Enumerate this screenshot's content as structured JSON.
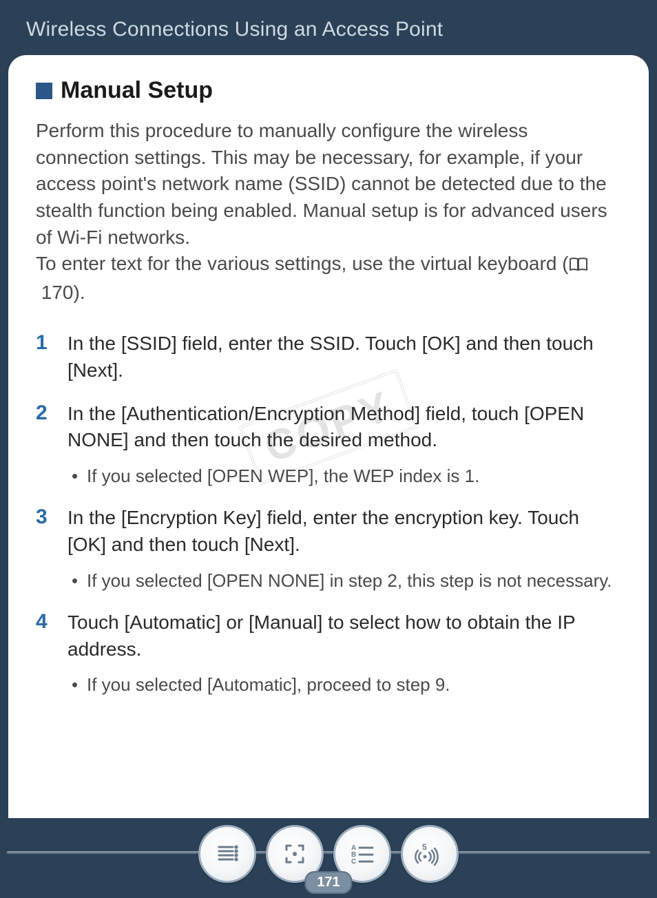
{
  "header": {
    "title": "Wireless Connections Using an Access Point"
  },
  "section": {
    "title": "Manual Setup",
    "intro_part1": "Perform this procedure to manually configure the wireless connection settings. This may be necessary, for example, if your access point's network name (SSID) cannot be detected due to the stealth function being enabled. Manual setup is for advanced users of Wi-Fi networks.",
    "intro_part2_prefix": "To enter text for the various settings, use the virtual keyboard (",
    "intro_xref": "170",
    "intro_part2_suffix": ")."
  },
  "steps": [
    {
      "num": "1",
      "text": "In the [SSID] field, enter the SSID. Touch [OK] and then touch [Next].",
      "bullets": []
    },
    {
      "num": "2",
      "text": "In the [Authentication/Encryption Method] field, touch [OPEN NONE] and then touch the desired method.",
      "bullets": [
        "If you selected [OPEN WEP], the WEP index is 1."
      ]
    },
    {
      "num": "3",
      "text": "In the [Encryption Key] field, enter the encryption key. Touch [OK] and then touch [Next].",
      "bullets": [
        "If you selected [OPEN NONE] in step 2, this step is not necessary."
      ]
    },
    {
      "num": "4",
      "text": "Touch [Automatic] or [Manual] to select how to obtain the IP address.",
      "bullets": [
        "If you selected [Automatic], proceed to step 9."
      ]
    }
  ],
  "watermark": "COPY",
  "footer": {
    "page_number": "171",
    "nav_icons": [
      "toc-icon",
      "expand-icon",
      "abc-icon",
      "wifi-icon"
    ],
    "badge_num": "5"
  }
}
